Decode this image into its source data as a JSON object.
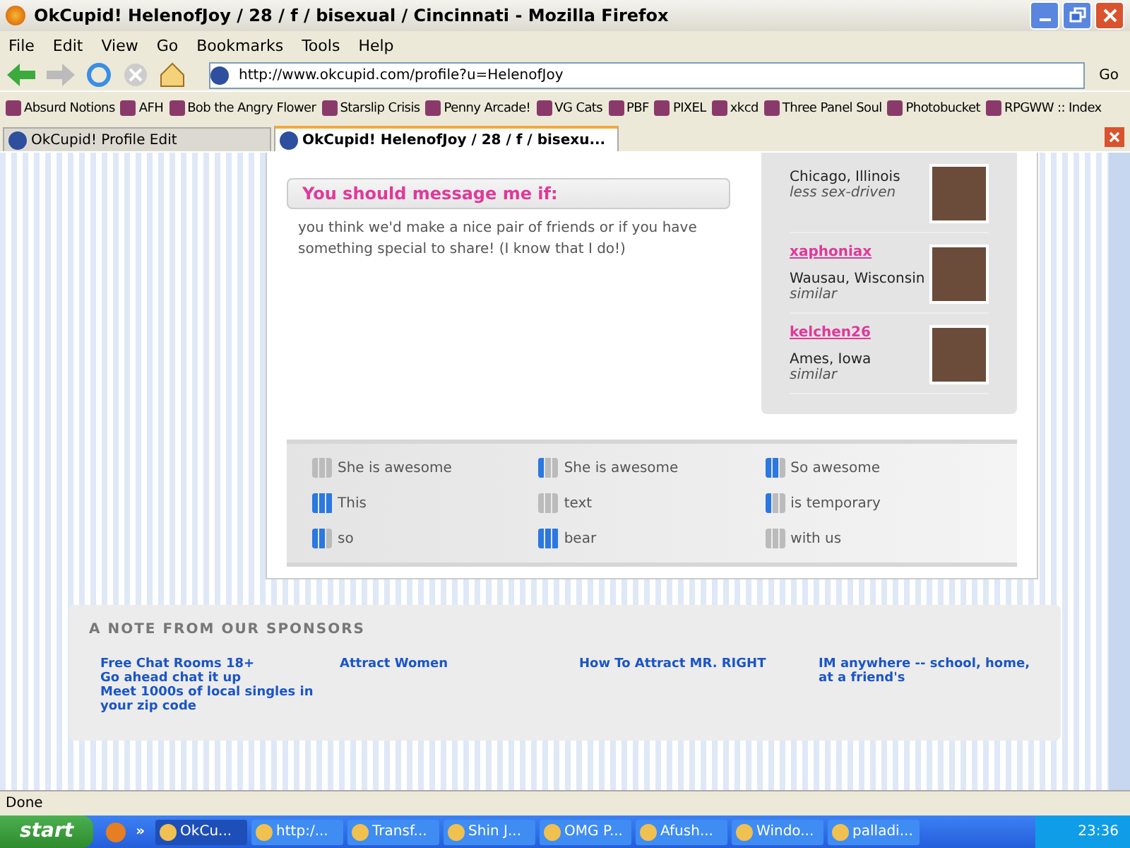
{
  "window": {
    "title": "OkCupid! HelenofJoy / 28 / f / bisexual / Cincinnati - Mozilla Firefox"
  },
  "menu": [
    "File",
    "Edit",
    "View",
    "Go",
    "Bookmarks",
    "Tools",
    "Help"
  ],
  "address": {
    "value": "http://www.okcupid.com/profile?u=HelenofJoy",
    "go": "Go"
  },
  "bookmarks": [
    "Absurd Notions",
    "AFH",
    "Bob the Angry Flower",
    "Starslip Crisis",
    "Penny Arcade!",
    "VG Cats",
    "PBF",
    "PIXEL",
    "xkcd",
    "Three Panel Soul",
    "Photobucket",
    "RPGWW :: Index"
  ],
  "tabs": [
    {
      "label": "OkCupid! Profile Edit",
      "selected": false
    },
    {
      "label": "OkCupid! HelenofJoy / 28 / f / bisexu...",
      "selected": true
    }
  ],
  "message": {
    "heading": "You should message me if:",
    "text": "you think we'd make a nice pair of friends or if you have something special to share!  (I know that I do!)"
  },
  "people": [
    {
      "location": "Chicago, Illinois",
      "note": "less sex-driven"
    },
    {
      "name": "xaphoniax",
      "location": "Wausau, Wisconsin",
      "note": "similar"
    },
    {
      "name": "kelchen26",
      "location": "Ames, Iowa",
      "note": "similar"
    }
  ],
  "traits": [
    {
      "label": "She is awesome",
      "level": 0
    },
    {
      "label": "She is awesome",
      "level": 0.33
    },
    {
      "label": "So awesome",
      "level": 0.67
    },
    {
      "label": "This",
      "level": 1
    },
    {
      "label": "text",
      "level": 0
    },
    {
      "label": "is temporary",
      "level": 0.33
    },
    {
      "label": "so",
      "level": 0.67
    },
    {
      "label": "bear",
      "level": 1
    },
    {
      "label": "with us",
      "level": 0
    }
  ],
  "sponsors": {
    "heading": "A NOTE FROM OUR SPONSORS",
    "links": [
      [
        "Free Chat Rooms 18+",
        "Go ahead chat it up",
        "Meet 1000s of local singles in your zip code"
      ],
      [
        "Attract Women"
      ],
      [
        "How To Attract MR. RIGHT"
      ],
      [
        "IM anywhere -- school, home, at a friend's"
      ]
    ]
  },
  "status_bar": "Done",
  "taskbar": {
    "start": "start",
    "more": "»",
    "items": [
      "OkCu...",
      "http:/...",
      "Transf...",
      "Shin J...",
      "OMG P...",
      "Afush...",
      "Windo...",
      "palladi..."
    ],
    "clock": "23:36"
  }
}
